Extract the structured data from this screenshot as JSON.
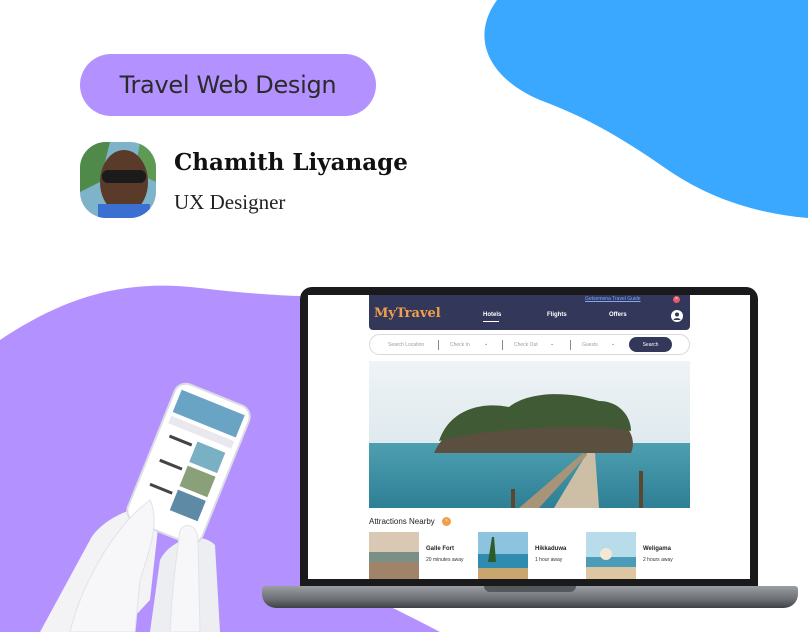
{
  "header": {
    "pill_label": "Travel Web Design",
    "author_name": "Chamith Liyanage",
    "author_role": "UX Designer"
  },
  "colors": {
    "blue_blob": "#3aa8ff",
    "purple": "#b392ff",
    "nav_bg": "#333759",
    "brand_orange": "#f0a04b"
  },
  "app": {
    "tip_link": "Getsemena Travel Guide",
    "brand": "MyTravel",
    "nav": [
      "Hotels",
      "Flights",
      "Offers"
    ],
    "search": {
      "location_placeholder": "Search Location",
      "checkin_placeholder": "Check In",
      "checkout_placeholder": "Check Out",
      "guests_placeholder": "Guests",
      "button": "Search"
    },
    "attractions_title": "Attractions Nearby",
    "attractions": [
      {
        "name": "Galle Fort",
        "time": "20 minutes away"
      },
      {
        "name": "Hikkaduwa",
        "time": "1 hour away"
      },
      {
        "name": "Weligama",
        "time": "2 hours away"
      }
    ]
  },
  "icons": {
    "user": "user-circle-icon",
    "chevron": "chevron-down-icon",
    "arrow": "arrow-right-icon",
    "close": "close-icon"
  }
}
